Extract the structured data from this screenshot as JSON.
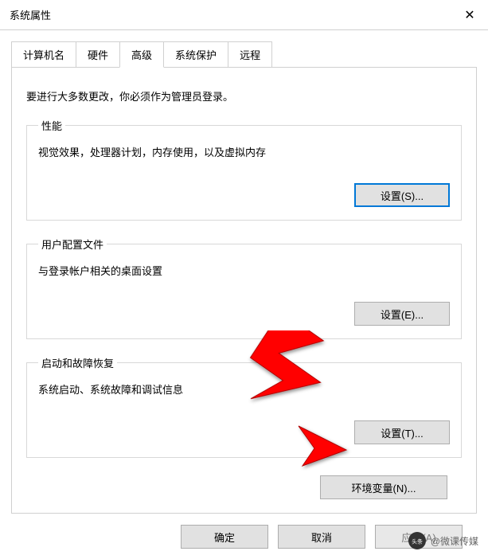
{
  "window": {
    "title": "系统属性",
    "close_glyph": "✕"
  },
  "tabs": {
    "items": [
      {
        "label": "计算机名"
      },
      {
        "label": "硬件"
      },
      {
        "label": "高级"
      },
      {
        "label": "系统保护"
      },
      {
        "label": "远程"
      }
    ],
    "active_index": 2
  },
  "advanced": {
    "info_text": "要进行大多数更改，你必须作为管理员登录。",
    "performance": {
      "legend": "性能",
      "desc": "视觉效果，处理器计划，内存使用，以及虚拟内存",
      "button": "设置(S)..."
    },
    "profiles": {
      "legend": "用户配置文件",
      "desc": "与登录帐户相关的桌面设置",
      "button": "设置(E)..."
    },
    "startup": {
      "legend": "启动和故障恢复",
      "desc": "系统启动、系统故障和调试信息",
      "button": "设置(T)..."
    },
    "env_button": "环境变量(N)..."
  },
  "footer": {
    "ok": "确定",
    "cancel": "取消",
    "apply": "应用(A)"
  },
  "watermark": {
    "avatar_glyph": "头条",
    "text": "@微课传媒"
  },
  "colors": {
    "arrow": "#ff0000",
    "focus_border": "#0078d7"
  }
}
